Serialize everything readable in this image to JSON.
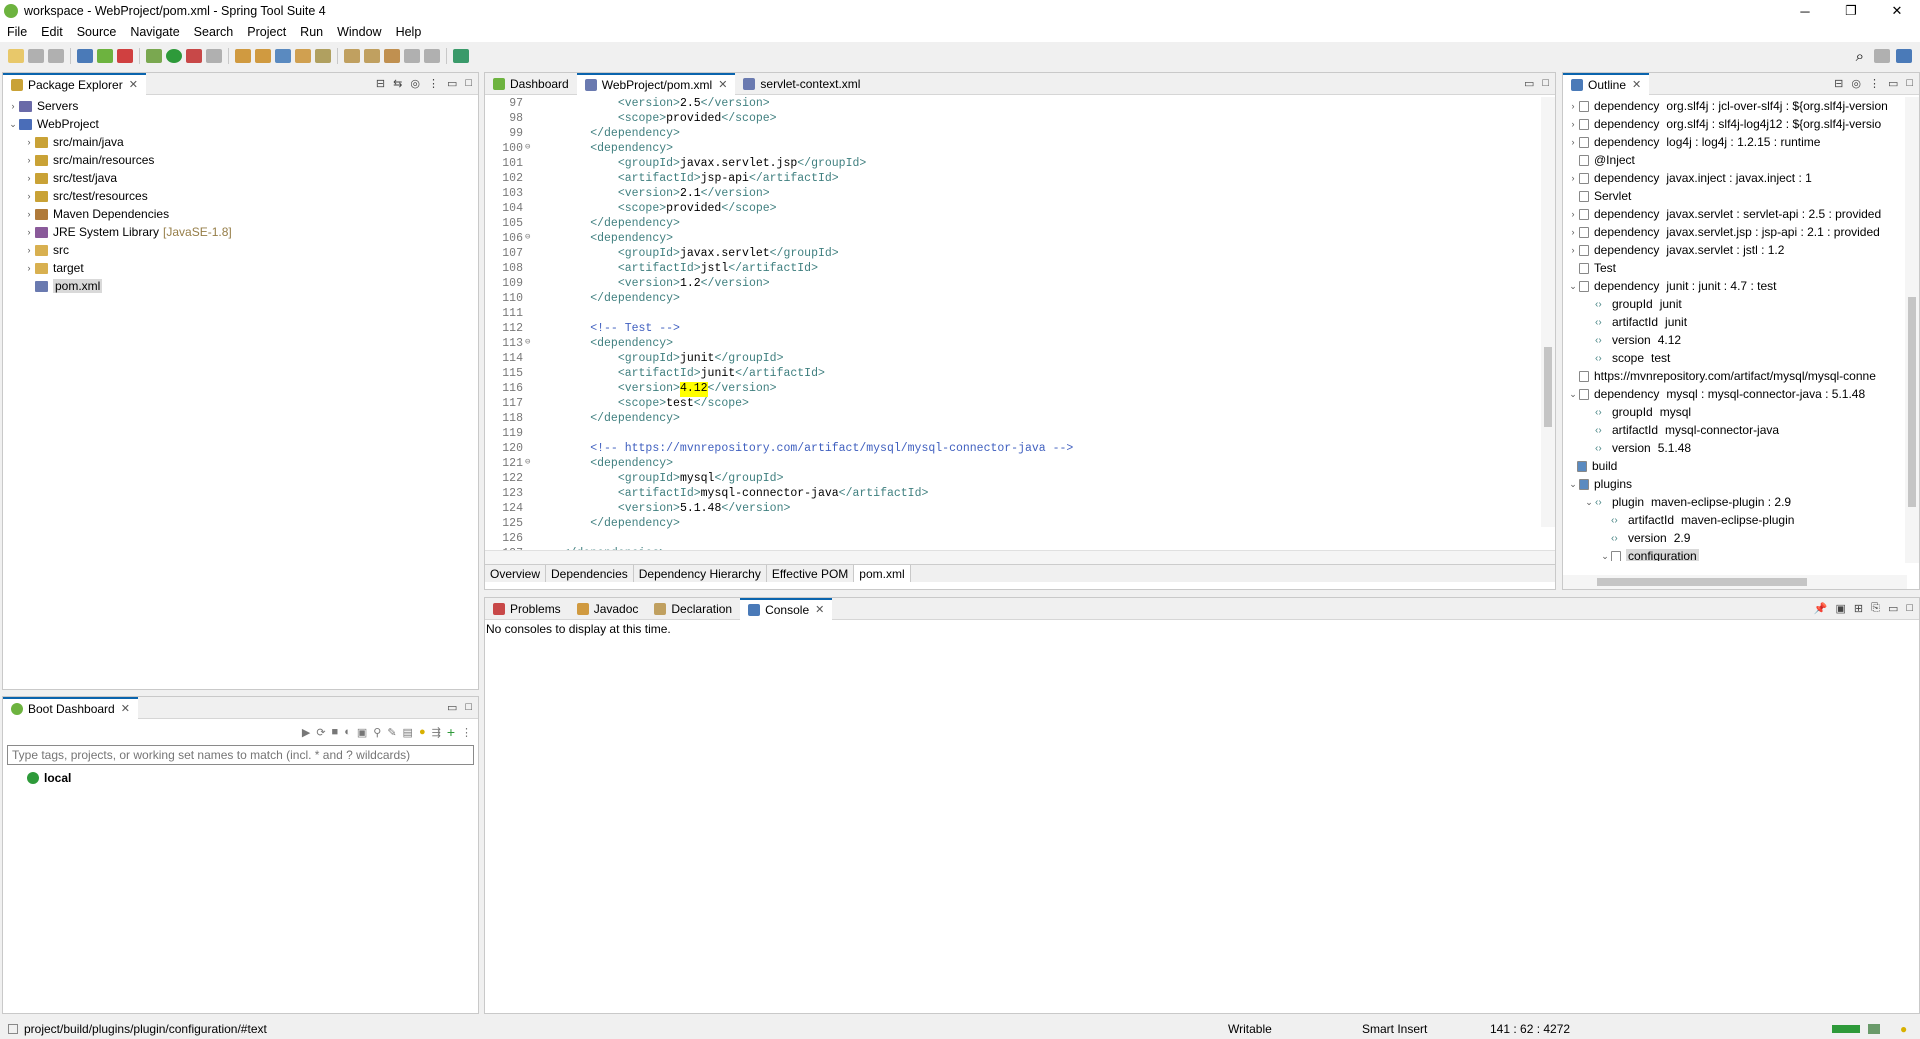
{
  "window": {
    "title": "workspace - WebProject/pom.xml - Spring Tool Suite 4",
    "min": "─",
    "max": "❐",
    "close": "✕"
  },
  "menu": [
    "File",
    "Edit",
    "Source",
    "Navigate",
    "Search",
    "Project",
    "Run",
    "Window",
    "Help"
  ],
  "package_explorer": {
    "title": "Package Explorer",
    "items": [
      {
        "label": "Servers",
        "suffix": "",
        "depth": 0,
        "tw": "›",
        "color": "#6a6aa8"
      },
      {
        "label": "WebProject",
        "suffix": "",
        "depth": 0,
        "tw": "⌄",
        "color": "#4a6db8"
      },
      {
        "label": "src/main/java",
        "suffix": "",
        "depth": 1,
        "tw": "›",
        "color": "#c9a236"
      },
      {
        "label": "src/main/resources",
        "suffix": "",
        "depth": 1,
        "tw": "›",
        "color": "#c9a236"
      },
      {
        "label": "src/test/java",
        "suffix": "",
        "depth": 1,
        "tw": "›",
        "color": "#c9a236"
      },
      {
        "label": "src/test/resources",
        "suffix": "",
        "depth": 1,
        "tw": "›",
        "color": "#c9a236"
      },
      {
        "label": "Maven Dependencies",
        "suffix": "",
        "depth": 1,
        "tw": "›",
        "color": "#b07a3a"
      },
      {
        "label": "JRE System Library",
        "suffix": "[JavaSE-1.8]",
        "depth": 1,
        "tw": "›",
        "color": "#8a5a9a"
      },
      {
        "label": "src",
        "suffix": "",
        "depth": 1,
        "tw": "›",
        "color": "#d8b050"
      },
      {
        "label": "target",
        "suffix": "",
        "depth": 1,
        "tw": "›",
        "color": "#d8b050"
      },
      {
        "label": "pom.xml",
        "suffix": "",
        "depth": 1,
        "tw": "",
        "color": "#6a7ab0"
      }
    ]
  },
  "boot_dashboard": {
    "title": "Boot Dashboard",
    "filter_placeholder": "Type tags, projects, or working set names to match (incl. * and ? wildcards)",
    "local": "local"
  },
  "editor": {
    "tabs": [
      "Dashboard",
      "WebProject/pom.xml",
      "servlet-context.xml"
    ],
    "lines": [
      {
        "n": "97",
        "f": "",
        "s": [
          [
            "t",
            "            <version>"
          ],
          [
            "x",
            "2.5"
          ],
          [
            "t",
            "</version>"
          ]
        ]
      },
      {
        "n": "98",
        "f": "",
        "s": [
          [
            "t",
            "            <scope>"
          ],
          [
            "x",
            "provided"
          ],
          [
            "t",
            "</scope>"
          ]
        ]
      },
      {
        "n": "99",
        "f": "",
        "s": [
          [
            "t",
            "        </dependency>"
          ]
        ]
      },
      {
        "n": "100",
        "f": "⊖",
        "s": [
          [
            "t",
            "        <dependency>"
          ]
        ]
      },
      {
        "n": "101",
        "f": "",
        "s": [
          [
            "t",
            "            <groupId>"
          ],
          [
            "x",
            "javax.servlet.jsp"
          ],
          [
            "t",
            "</groupId>"
          ]
        ]
      },
      {
        "n": "102",
        "f": "",
        "s": [
          [
            "t",
            "            <artifactId>"
          ],
          [
            "x",
            "jsp-api"
          ],
          [
            "t",
            "</artifactId>"
          ]
        ]
      },
      {
        "n": "103",
        "f": "",
        "s": [
          [
            "t",
            "            <version>"
          ],
          [
            "x",
            "2.1"
          ],
          [
            "t",
            "</version>"
          ]
        ]
      },
      {
        "n": "104",
        "f": "",
        "s": [
          [
            "t",
            "            <scope>"
          ],
          [
            "x",
            "provided"
          ],
          [
            "t",
            "</scope>"
          ]
        ]
      },
      {
        "n": "105",
        "f": "",
        "s": [
          [
            "t",
            "        </dependency>"
          ]
        ]
      },
      {
        "n": "106",
        "f": "⊖",
        "s": [
          [
            "t",
            "        <dependency>"
          ]
        ]
      },
      {
        "n": "107",
        "f": "",
        "s": [
          [
            "t",
            "            <groupId>"
          ],
          [
            "x",
            "javax.servlet"
          ],
          [
            "t",
            "</groupId>"
          ]
        ]
      },
      {
        "n": "108",
        "f": "",
        "s": [
          [
            "t",
            "            <artifactId>"
          ],
          [
            "x",
            "jstl"
          ],
          [
            "t",
            "</artifactId>"
          ]
        ]
      },
      {
        "n": "109",
        "f": "",
        "s": [
          [
            "t",
            "            <version>"
          ],
          [
            "x",
            "1.2"
          ],
          [
            "t",
            "</version>"
          ]
        ]
      },
      {
        "n": "110",
        "f": "",
        "s": [
          [
            "t",
            "        </dependency>"
          ]
        ]
      },
      {
        "n": "111",
        "f": "",
        "s": []
      },
      {
        "n": "112",
        "f": "",
        "s": [
          [
            "c",
            "        <!-- Test -->"
          ]
        ]
      },
      {
        "n": "113",
        "f": "⊖",
        "s": [
          [
            "t",
            "        <dependency>"
          ]
        ]
      },
      {
        "n": "114",
        "f": "",
        "s": [
          [
            "t",
            "            <groupId>"
          ],
          [
            "x",
            "junit"
          ],
          [
            "t",
            "</groupId>"
          ]
        ]
      },
      {
        "n": "115",
        "f": "",
        "s": [
          [
            "t",
            "            <artifactId>"
          ],
          [
            "x",
            "junit"
          ],
          [
            "t",
            "</artifactId>"
          ]
        ]
      },
      {
        "n": "116",
        "f": "",
        "s": [
          [
            "t",
            "            <version>"
          ],
          [
            "h",
            "4.12"
          ],
          [
            "t",
            "</version>"
          ]
        ]
      },
      {
        "n": "117",
        "f": "",
        "s": [
          [
            "t",
            "            <scope>"
          ],
          [
            "x",
            "test"
          ],
          [
            "t",
            "</scope>"
          ]
        ]
      },
      {
        "n": "118",
        "f": "",
        "s": [
          [
            "t",
            "        </dependency>"
          ]
        ]
      },
      {
        "n": "119",
        "f": "",
        "s": []
      },
      {
        "n": "120",
        "f": "",
        "s": [
          [
            "c",
            "        <!-- https://mvnrepository.com/artifact/mysql/mysql-connector-java -->"
          ]
        ]
      },
      {
        "n": "121",
        "f": "⊖",
        "s": [
          [
            "t",
            "        <dependency>"
          ]
        ]
      },
      {
        "n": "122",
        "f": "",
        "s": [
          [
            "t",
            "            <groupId>"
          ],
          [
            "x",
            "mysql"
          ],
          [
            "t",
            "</groupId>"
          ]
        ]
      },
      {
        "n": "123",
        "f": "",
        "s": [
          [
            "t",
            "            <artifactId>"
          ],
          [
            "x",
            "mysql-connector-java"
          ],
          [
            "t",
            "</artifactId>"
          ]
        ]
      },
      {
        "n": "124",
        "f": "",
        "s": [
          [
            "t",
            "            <version>"
          ],
          [
            "x",
            "5.1.48"
          ],
          [
            "t",
            "</version>"
          ]
        ]
      },
      {
        "n": "125",
        "f": "",
        "s": [
          [
            "t",
            "        </dependency>"
          ]
        ]
      },
      {
        "n": "126",
        "f": "",
        "s": []
      },
      {
        "n": "127",
        "f": "",
        "s": [
          [
            "t",
            "    </dependencies>"
          ]
        ]
      }
    ],
    "bottom_tabs": [
      "Overview",
      "Dependencies",
      "Dependency Hierarchy",
      "Effective POM",
      "pom.xml"
    ]
  },
  "console": {
    "tabs": [
      "Problems",
      "Javadoc",
      "Declaration",
      "Console"
    ],
    "message": "No consoles to display at this time."
  },
  "outline": {
    "title": "Outline",
    "items": [
      {
        "d": 0,
        "tw": "›",
        "k": "dependency",
        "v": "org.slf4j : jcl-over-slf4j : ${org.slf4j-version"
      },
      {
        "d": 0,
        "tw": "›",
        "k": "dependency",
        "v": "org.slf4j : slf4j-log4j12 : ${org.slf4j-versio"
      },
      {
        "d": 0,
        "tw": "›",
        "k": "dependency",
        "v": "log4j : log4j : 1.2.15 : runtime"
      },
      {
        "d": 0,
        "tw": "",
        "k": "@Inject",
        "v": ""
      },
      {
        "d": 0,
        "tw": "›",
        "k": "dependency",
        "v": "javax.inject : javax.inject : 1"
      },
      {
        "d": 0,
        "tw": "",
        "k": "Servlet",
        "v": ""
      },
      {
        "d": 0,
        "tw": "›",
        "k": "dependency",
        "v": "javax.servlet : servlet-api : 2.5 : provided"
      },
      {
        "d": 0,
        "tw": "›",
        "k": "dependency",
        "v": "javax.servlet.jsp : jsp-api : 2.1 : provided"
      },
      {
        "d": 0,
        "tw": "›",
        "k": "dependency",
        "v": "javax.servlet : jstl : 1.2"
      },
      {
        "d": 0,
        "tw": "",
        "k": "Test",
        "v": ""
      },
      {
        "d": 0,
        "tw": "⌄",
        "k": "dependency",
        "v": "junit : junit : 4.7 : test"
      },
      {
        "d": 1,
        "tw": "",
        "k": "groupId",
        "v": "junit"
      },
      {
        "d": 1,
        "tw": "",
        "k": "artifactId",
        "v": "junit"
      },
      {
        "d": 1,
        "tw": "",
        "k": "version",
        "v": "4.12"
      },
      {
        "d": 1,
        "tw": "",
        "k": "scope",
        "v": "test"
      },
      {
        "d": 0,
        "tw": "",
        "k": "https://mvnrepository.com/artifact/mysql/mysql-conne",
        "v": ""
      },
      {
        "d": 0,
        "tw": "⌄",
        "k": "dependency",
        "v": "mysql : mysql-connector-java : 5.1.48"
      },
      {
        "d": 1,
        "tw": "",
        "k": "groupId",
        "v": "mysql"
      },
      {
        "d": 1,
        "tw": "",
        "k": "artifactId",
        "v": "mysql-connector-java"
      },
      {
        "d": 1,
        "tw": "",
        "k": "version",
        "v": "5.1.48"
      },
      {
        "d": -1,
        "tw": "",
        "k": "build",
        "v": ""
      },
      {
        "d": 0,
        "tw": "⌄",
        "k": "plugins",
        "v": ""
      },
      {
        "d": 1,
        "tw": "⌄",
        "k": "plugin",
        "v": "maven-eclipse-plugin : 2.9"
      },
      {
        "d": 2,
        "tw": "",
        "k": "artifactId",
        "v": "maven-eclipse-plugin"
      },
      {
        "d": 2,
        "tw": "",
        "k": "version",
        "v": "2.9"
      },
      {
        "d": 2,
        "tw": "⌄",
        "k": "configuration",
        "v": ""
      }
    ]
  },
  "status": {
    "path": "project/build/plugins/plugin/configuration/#text",
    "mode": "Writable",
    "insert": "Smart Insert",
    "position": "141 : 62 : 4272"
  }
}
